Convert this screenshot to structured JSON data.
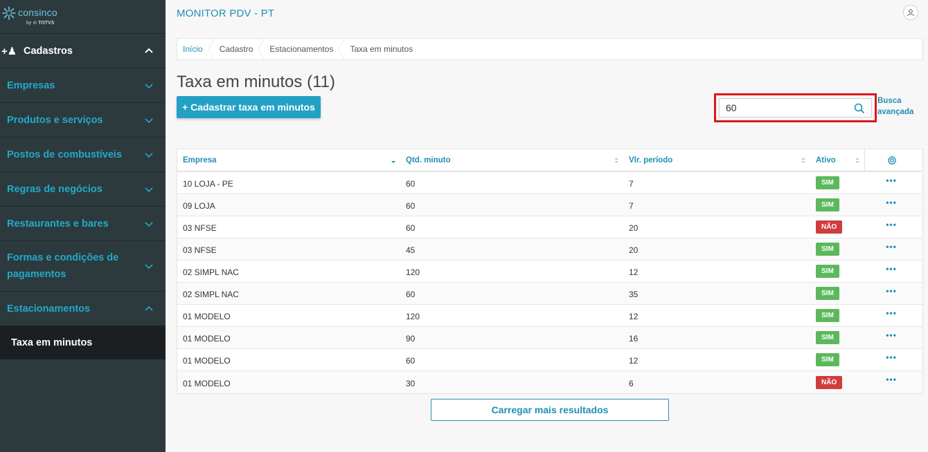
{
  "brand": {
    "name": "consinco",
    "by": "by",
    "totvs": "TOTVS"
  },
  "app_title": "MONITOR PDV - PT",
  "sidebar": {
    "main": "Cadastros",
    "groups": [
      {
        "label": "Empresas"
      },
      {
        "label": "Produtos e serviços"
      },
      {
        "label": "Postos de combustíveis"
      },
      {
        "label": "Regras de negócios"
      },
      {
        "label": "Restaurantes e bares"
      },
      {
        "label": "Formas e condições de pagamentos"
      },
      {
        "label": "Estacionamentos"
      }
    ],
    "active_sub": "Taxa em minutos"
  },
  "breadcrumb": [
    "Início",
    "Cadastro",
    "Estacionamentos",
    "Taxa em minutos"
  ],
  "page": {
    "title": "Taxa em minutos (11)",
    "add_button": "+ Cadastrar taxa em minutos",
    "search_value": "60",
    "advanced_search": "Busca avançada",
    "load_more": "Carregar mais resultados"
  },
  "table": {
    "columns": [
      "Empresa",
      "Qtd. minuto",
      "Vlr. período",
      "Ativo"
    ],
    "rows": [
      {
        "empresa": "10 LOJA - PE",
        "qtd": "60",
        "vlr": "7",
        "ativo": "SIM"
      },
      {
        "empresa": "09 LOJA",
        "qtd": "60",
        "vlr": "7",
        "ativo": "SIM"
      },
      {
        "empresa": "03 NFSE",
        "qtd": "60",
        "vlr": "20",
        "ativo": "NÃO"
      },
      {
        "empresa": "03 NFSE",
        "qtd": "45",
        "vlr": "20",
        "ativo": "SIM"
      },
      {
        "empresa": "02 SIMPL NAC",
        "qtd": "120",
        "vlr": "12",
        "ativo": "SIM"
      },
      {
        "empresa": "02 SIMPL NAC",
        "qtd": "60",
        "vlr": "35",
        "ativo": "SIM"
      },
      {
        "empresa": "01 MODELO",
        "qtd": "120",
        "vlr": "12",
        "ativo": "SIM"
      },
      {
        "empresa": "01 MODELO",
        "qtd": "90",
        "vlr": "16",
        "ativo": "SIM"
      },
      {
        "empresa": "01 MODELO",
        "qtd": "60",
        "vlr": "12",
        "ativo": "SIM"
      },
      {
        "empresa": "01 MODELO",
        "qtd": "30",
        "vlr": "6",
        "ativo": "NÃO"
      }
    ],
    "row_action": "•••"
  },
  "colors": {
    "accent": "#23a1c4",
    "sidebar": "#2c3a3e",
    "active": "#5cb85c",
    "inactive": "#d03d3d",
    "highlight": "#e0141e"
  }
}
